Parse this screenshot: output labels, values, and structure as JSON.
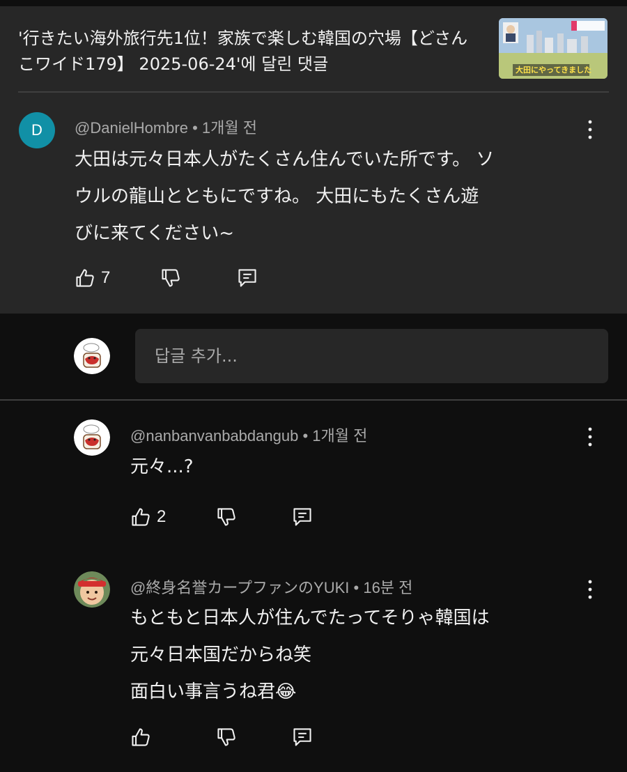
{
  "header": {
    "video_title": "'行きたい海外旅行先1位！家族で楽しむ韓国の穴場【どさんこワイド179】 2025-06-24'에 달린 댓글",
    "thumbnail_caption": "大田にやってきました"
  },
  "main_comment": {
    "avatar_letter": "D",
    "author": "@DanielHombre",
    "time": "1개월 전",
    "text_lines": [
      "大田は元々日本人がたくさん住んでいた所です。 ソ",
      "ウルの龍山とともにですね。 大田にもたくさん遊",
      "びに来てください~"
    ],
    "likes": "7"
  },
  "reply_box": {
    "placeholder": "답글 추가..."
  },
  "replies": [
    {
      "author": "@nanbanvanbabdangub",
      "time": "1개월 전",
      "text_lines": [
        "元々...?"
      ],
      "likes": "2"
    },
    {
      "author": "@終身名誉カープファンのYUKI",
      "time": "16분 전",
      "text_lines": [
        "もともと日本人が住んでたってそりゃ韓国は",
        "元々日本国だからね笑",
        "面白い事言うね君😂"
      ],
      "likes": ""
    }
  ],
  "icons": {
    "like": "thumbs-up-icon",
    "dislike": "thumbs-down-icon",
    "reply": "reply-icon",
    "more": "more-vert-icon"
  },
  "colors": {
    "header_bg": "#272727",
    "page_bg": "#0f0f0f",
    "avatar_d": "#1190a6",
    "secondary_text": "#aaaaaa"
  }
}
